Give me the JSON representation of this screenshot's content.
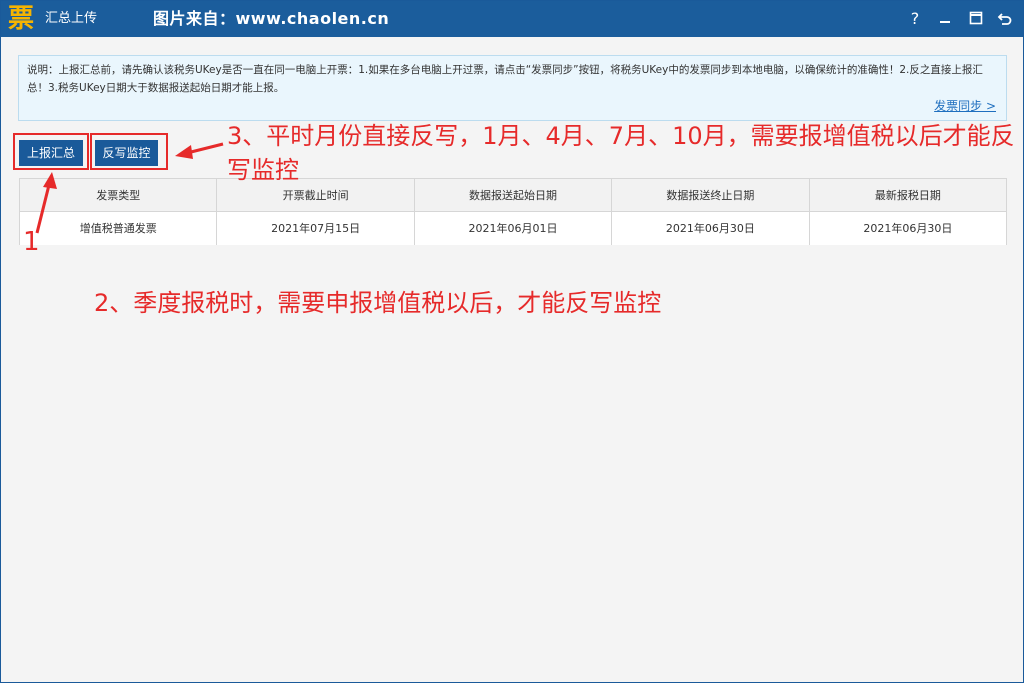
{
  "window": {
    "logo_char": "票",
    "title": "汇总上传",
    "source_text": "图片来自：www.chaolen.cn",
    "controls": {
      "help": "?",
      "minimize_icon": "minimize-icon",
      "maximize_icon": "maximize-icon",
      "back_icon": "return-icon"
    }
  },
  "notice": {
    "text": "说明：上报汇总前，请先确认该税务UKey是否一直在同一电脑上开票：1.如果在多台电脑上开过票，请点击“发票同步”按钮，将税务UKey中的发票同步到本地电脑，以确保统计的准确性！2.反之直接上报汇总！3.税务UKey日期大于数据报送起始日期才能上报。",
    "sync_link": "发票同步 >"
  },
  "toolbar": {
    "report_summary": "上报汇总",
    "reverse_monitor": "反写监控"
  },
  "table": {
    "headers": [
      "发票类型",
      "开票截止时间",
      "数据报送起始日期",
      "数据报送终止日期",
      "最新报税日期"
    ],
    "rows": [
      [
        "增值税普通发票",
        "2021年07月15日",
        "2021年06月01日",
        "2021年06月30日",
        "2021年06月30日"
      ]
    ]
  },
  "annotations": {
    "note_1": "1",
    "note_2": "2、季度报税时，需要申报增值税以后，才能反写监控",
    "note_3": "3、平时月份直接反写，1月、4月、7月、10月，需要报增值税以后才能反写监控",
    "color": "#e62a2a"
  },
  "colors": {
    "titlebar": "#1b5d9c",
    "button": "#1a5a9a",
    "logo": "#f6b400",
    "link": "#1f6fbf"
  }
}
